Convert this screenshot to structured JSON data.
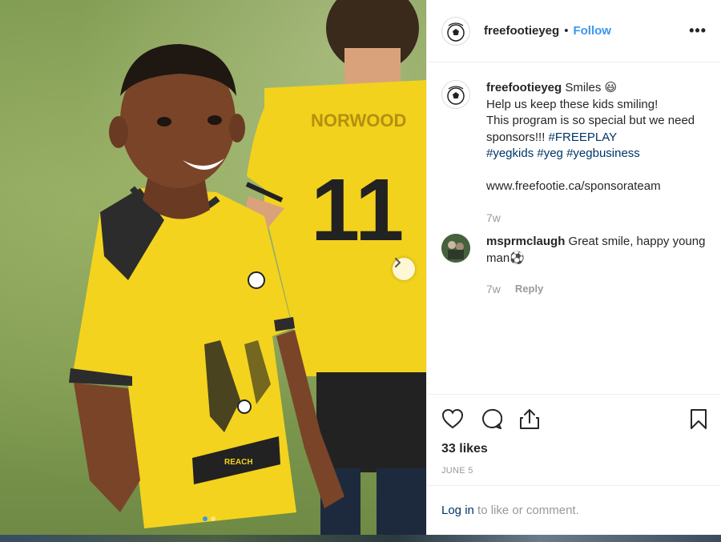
{
  "post": {
    "username": "freefootieyeg",
    "follow_label": "Follow",
    "dot_separator": "•",
    "more_label": "•••"
  },
  "caption": {
    "username": "freefootieyeg",
    "line1": " Smiles 😃",
    "line2": "Help us keep these kids smiling!",
    "line3": "This program is so special but we need sponsors!!! ",
    "tag_freeplay": "#FREEPLAY",
    "tag_yegkids": "#yegkids",
    "tag_yeg": "#yeg",
    "tag_yegbusiness": "#yegbusiness",
    "link": "www.freefootie.ca/sponsorateam",
    "time": "7w"
  },
  "comment": {
    "username": "msprmclaugh",
    "text": " Great smile, happy young man⚽",
    "time": "7w",
    "reply_label": "Reply"
  },
  "actions": {
    "likes": "33 likes",
    "date": "JUNE 5"
  },
  "login": {
    "login_label": "Log in",
    "rest": " to like or comment."
  },
  "photo": {
    "jersey_name": "NORWOOD",
    "jersey_number": "11"
  },
  "carousel": {
    "total": 2,
    "current": 1
  },
  "colors": {
    "link": "#3897f0",
    "hashtag": "#003569",
    "jersey": "#f2d21c"
  }
}
